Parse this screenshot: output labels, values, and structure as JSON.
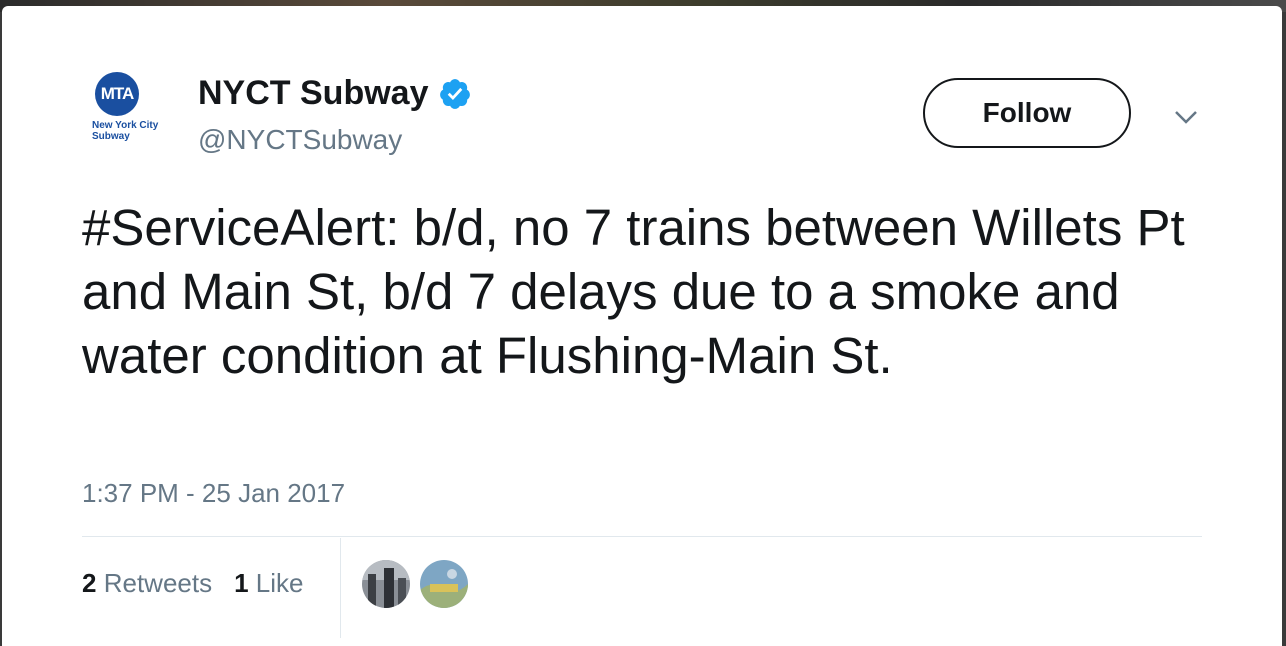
{
  "account": {
    "logo_text": "MTA",
    "logo_subtext": "New York City Subway",
    "display_name": "NYCT Subway",
    "handle": "@NYCTSubway",
    "verified_icon": "verified-badge-icon",
    "brand_color": "#1a4fa0",
    "verified_color": "#1da1f2"
  },
  "actions": {
    "follow_label": "Follow",
    "more_icon": "chevron-down-icon"
  },
  "tweet": {
    "text": "#ServiceAlert: b/d, no 7 trains between Willets Pt and Main St, b/d 7 delays due to a smoke and water condition at Flushing-Main St.",
    "timestamp": "1:37 PM - 25 Jan 2017"
  },
  "stats": {
    "retweets_count": "2",
    "retweets_label": "Retweets",
    "likes_count": "1",
    "likes_label": "Like"
  }
}
